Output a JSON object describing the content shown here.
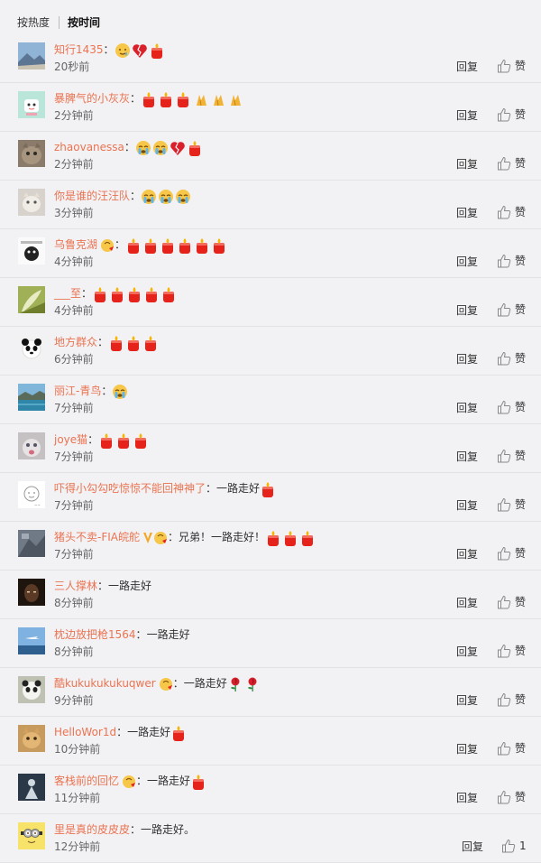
{
  "sort": {
    "hot": "按热度",
    "time": "按时间"
  },
  "colors": {
    "username": "#eb7350",
    "divider": "#e3e3e6",
    "background": "#f2f2f5"
  },
  "comments": [
    {
      "user": "知行1435",
      "avatar": "landscape",
      "emojis": [
        "tear-smile",
        "broken-heart",
        "candle"
      ],
      "text": "",
      "time": "20秒前",
      "reply": "回复",
      "like": "赞"
    },
    {
      "user": "暴脾气的小灰灰",
      "avatar": "cartoon",
      "emojis": [
        "candle",
        "candle",
        "candle",
        "pray",
        "pray",
        "pray"
      ],
      "text": "",
      "time": "2分钟前",
      "reply": "回复",
      "like": "赞"
    },
    {
      "user": "zhaovanessa",
      "avatar": "cat-photo",
      "emojis": [
        "cry",
        "cry",
        "broken-heart",
        "candle"
      ],
      "text": "",
      "time": "2分钟前",
      "reply": "回复",
      "like": "赞"
    },
    {
      "user": "你是谁的汪汪队",
      "avatar": "kitten",
      "emojis": [
        "cry",
        "cry",
        "cry"
      ],
      "text": "",
      "time": "3分钟前",
      "reply": "回复",
      "like": "赞"
    },
    {
      "user": "乌鲁克湖",
      "avatar": "sketch",
      "badge": "member",
      "emojis": [
        "candle",
        "candle",
        "candle",
        "candle",
        "candle",
        "candle"
      ],
      "text": "",
      "time": "4分钟前",
      "reply": "回复",
      "like": "赞"
    },
    {
      "user": "___至",
      "avatar": "plant",
      "emojis": [
        "candle",
        "candle",
        "candle",
        "candle",
        "candle"
      ],
      "text": "",
      "time": "4分钟前",
      "reply": "回复",
      "like": "赞"
    },
    {
      "user": "地方群众",
      "avatar": "panda-doll",
      "emojis": [
        "candle",
        "candle",
        "candle"
      ],
      "text": "",
      "time": "6分钟前",
      "reply": "回复",
      "like": "赞"
    },
    {
      "user": "丽江-青鸟",
      "avatar": "lake",
      "emojis": [
        "cry"
      ],
      "text": "",
      "time": "7分钟前",
      "reply": "回复",
      "like": "赞"
    },
    {
      "user": "joye猫",
      "avatar": "cat-face",
      "emojis": [
        "candle",
        "candle",
        "candle"
      ],
      "text": "",
      "time": "7分钟前",
      "reply": "回复",
      "like": "赞"
    },
    {
      "user": "吓得小勾勾吃惊惊不能回神神了",
      "avatar": "doodle",
      "emojis": [
        "candle"
      ],
      "text": "一路走好",
      "time": "7分钟前",
      "reply": "回复",
      "like": "赞"
    },
    {
      "user": "猪头不卖-FIA皖舵",
      "avatar": "grey-photo",
      "badge": "verified-member",
      "emojis": [
        "candle",
        "candle",
        "candle"
      ],
      "text": "兄弟！一路走好！",
      "time": "7分钟前",
      "reply": "回复",
      "like": "赞"
    },
    {
      "user": "三人撑林",
      "avatar": "dark-face",
      "emojis": [],
      "text": "一路走好",
      "time": "8分钟前",
      "reply": "回复",
      "like": "赞"
    },
    {
      "user": "枕边放把枪1564",
      "avatar": "sky-plane",
      "emojis": [],
      "text": "一路走好",
      "time": "8分钟前",
      "reply": "回复",
      "like": "赞"
    },
    {
      "user": "酷kukukukukuqwer",
      "avatar": "panda",
      "badge": "member",
      "emojis": [
        "rose",
        "rose"
      ],
      "text": "一路走好",
      "time": "9分钟前",
      "reply": "回复",
      "like": "赞"
    },
    {
      "user": "HelloWor1d",
      "avatar": "orange-cat",
      "emojis": [
        "candle"
      ],
      "text": "一路走好",
      "time": "10分钟前",
      "reply": "回复",
      "like": "赞"
    },
    {
      "user": "客栈前的回忆",
      "avatar": "dark-figure",
      "badge": "member",
      "emojis": [
        "candle"
      ],
      "text": "一路走好",
      "time": "11分钟前",
      "reply": "回复",
      "like": "赞"
    },
    {
      "user": "里是真的皮皮皮",
      "avatar": "minion",
      "emojis": [],
      "text": "一路走好。",
      "time": "12分钟前",
      "reply": "回复",
      "like": "1"
    }
  ]
}
